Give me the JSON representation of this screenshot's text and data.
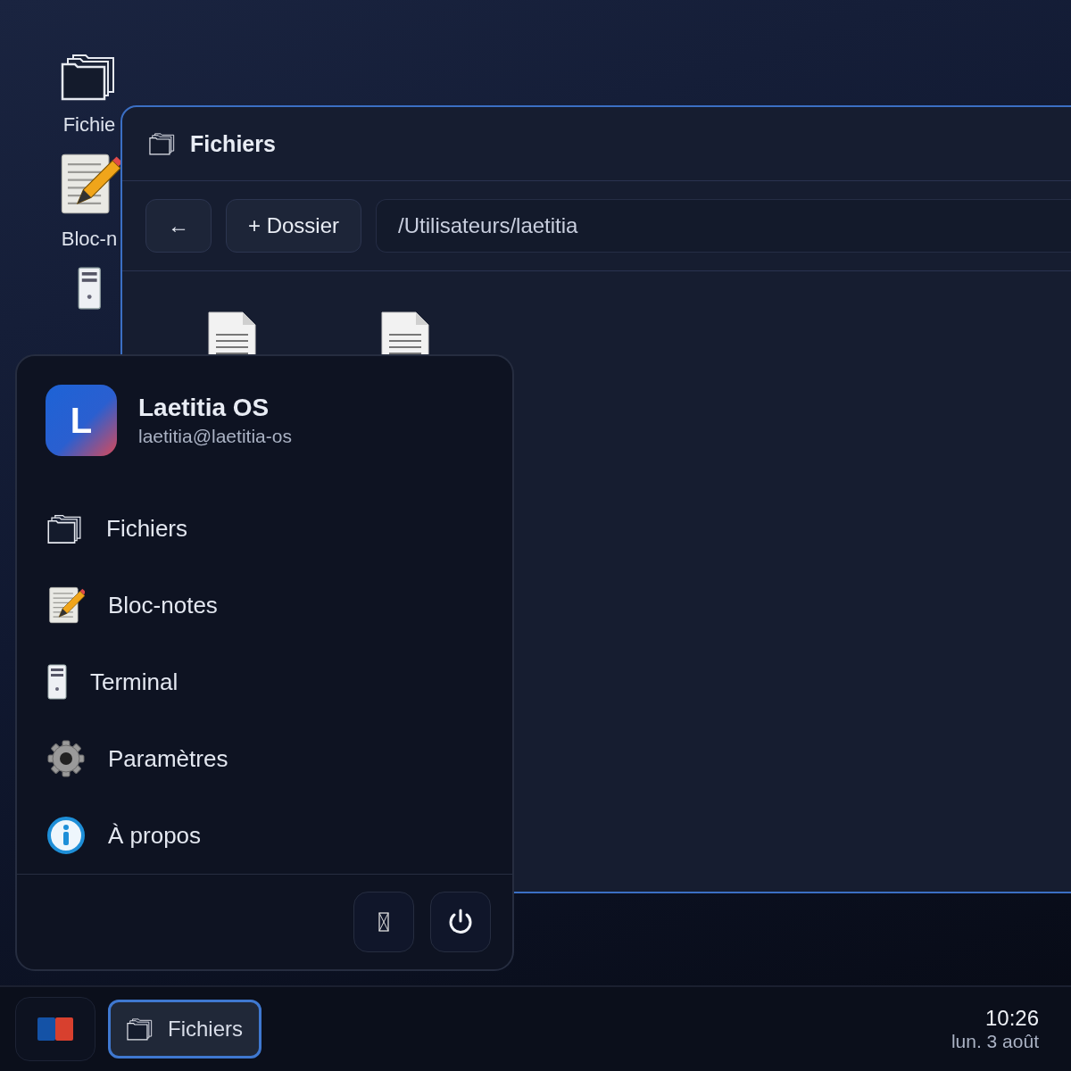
{
  "desktop_icons": [
    {
      "kind": "files",
      "label": "Fichie"
    },
    {
      "kind": "notepad",
      "label": "Bloc-n"
    },
    {
      "kind": "terminal"
    }
  ],
  "window": {
    "title": "Fichiers",
    "back_button": "←",
    "new_folder_button": "+ Dossier",
    "path": "/Utilisateurs/laetitia",
    "files": [
      {
        "kind": "document"
      },
      {
        "kind": "document"
      }
    ]
  },
  "start_menu": {
    "avatar": "L",
    "title": "Laetitia OS",
    "subtitle": "laetitia@laetitia-os",
    "items": [
      {
        "kind": "files",
        "label": "Fichiers"
      },
      {
        "kind": "notepad",
        "label": "Bloc-notes"
      },
      {
        "kind": "terminal",
        "label": "Terminal"
      },
      {
        "kind": "settings",
        "label": "Paramètres"
      },
      {
        "kind": "about",
        "label": "À propos"
      }
    ],
    "footer_buttons": [
      {
        "kind": "missing-glyph"
      },
      {
        "kind": "power"
      }
    ]
  },
  "taskbar": {
    "tasks": [
      {
        "label": "Fichiers",
        "selected": true
      }
    ],
    "time": "10:26",
    "date": "lun. 3 août"
  }
}
